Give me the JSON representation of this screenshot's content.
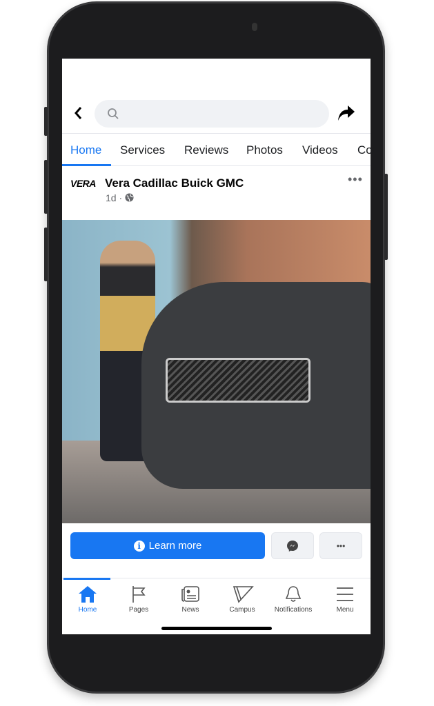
{
  "header": {
    "back_icon": "chevron-left-icon",
    "search_placeholder": "",
    "share_icon": "share-arrow-icon"
  },
  "tabs": [
    {
      "label": "Home",
      "active": true
    },
    {
      "label": "Services"
    },
    {
      "label": "Reviews"
    },
    {
      "label": "Photos"
    },
    {
      "label": "Videos"
    },
    {
      "label": "Co"
    }
  ],
  "post": {
    "logo_text": "VERA",
    "page_name": "Vera Cadillac Buick GMC",
    "time": "1d ·",
    "privacy_icon": "globe-icon",
    "more_icon": "•••"
  },
  "actions": {
    "learn_more": "Learn more",
    "messenger_icon": "messenger-icon",
    "more": "•••"
  },
  "bottom_nav": [
    {
      "label": "Home",
      "active": true
    },
    {
      "label": "Pages"
    },
    {
      "label": "News"
    },
    {
      "label": "Campus"
    },
    {
      "label": "Notifications"
    },
    {
      "label": "Menu"
    }
  ],
  "colors": {
    "accent": "#1877f2",
    "search_bg": "#f0f2f5"
  }
}
